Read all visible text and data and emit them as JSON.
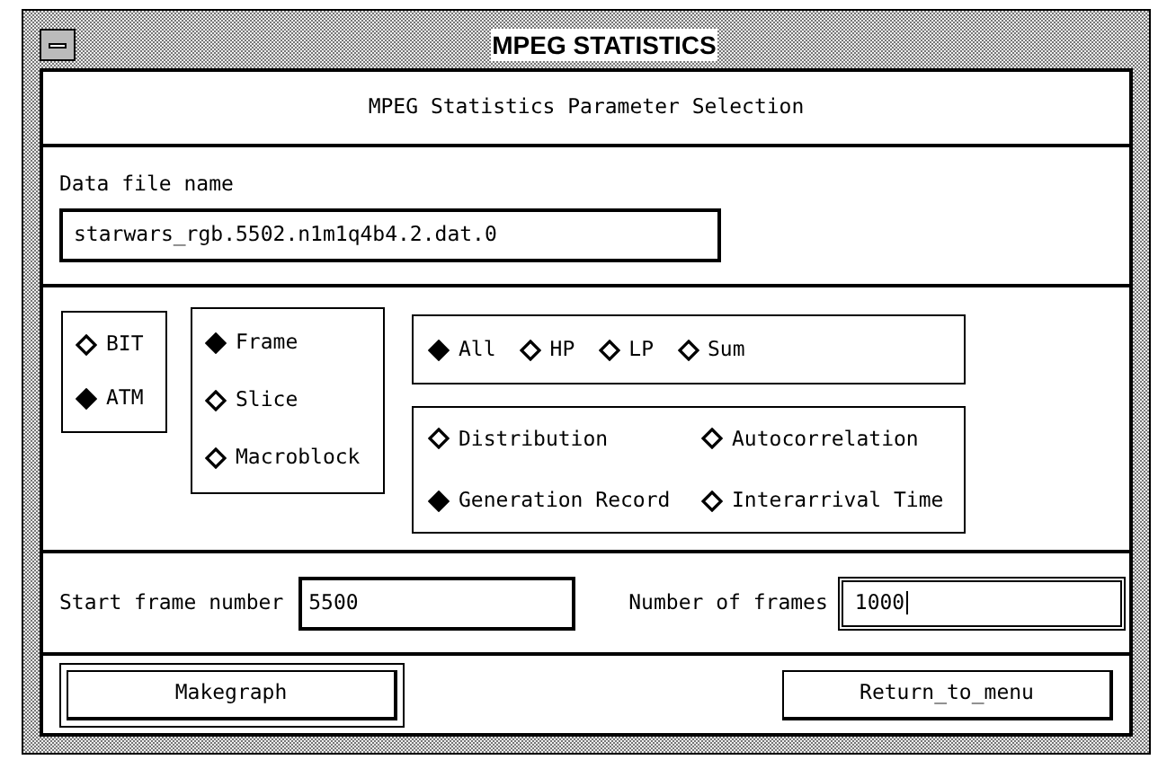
{
  "window": {
    "title": "MPEG STATISTICS"
  },
  "heading": "MPEG Statistics Parameter Selection",
  "data_file": {
    "label": "Data file name",
    "value": "starwars_rgb.5502.n1m1q4b4.2.dat.0"
  },
  "network": [
    {
      "label": "BIT",
      "selected": false
    },
    {
      "label": "ATM",
      "selected": true
    }
  ],
  "unit": [
    {
      "label": "Frame",
      "selected": true
    },
    {
      "label": "Slice",
      "selected": false
    },
    {
      "label": "Macroblock",
      "selected": false
    }
  ],
  "layer": [
    {
      "label": "All",
      "selected": true
    },
    {
      "label": "HP",
      "selected": false
    },
    {
      "label": "LP",
      "selected": false
    },
    {
      "label": "Sum",
      "selected": false
    }
  ],
  "statistic": [
    {
      "label": "Distribution",
      "selected": false
    },
    {
      "label": "Autocorrelation",
      "selected": false
    },
    {
      "label": "Generation Record",
      "selected": true
    },
    {
      "label": "Interarrival Time",
      "selected": false
    }
  ],
  "start_frame": {
    "label": "Start frame number",
    "value": "5500"
  },
  "frame_count": {
    "label": "Number of frames",
    "value": "1000",
    "focused": true
  },
  "buttons": [
    {
      "label": "Makegraph",
      "default": true
    },
    {
      "label": "Return_to_menu",
      "default": false
    }
  ]
}
